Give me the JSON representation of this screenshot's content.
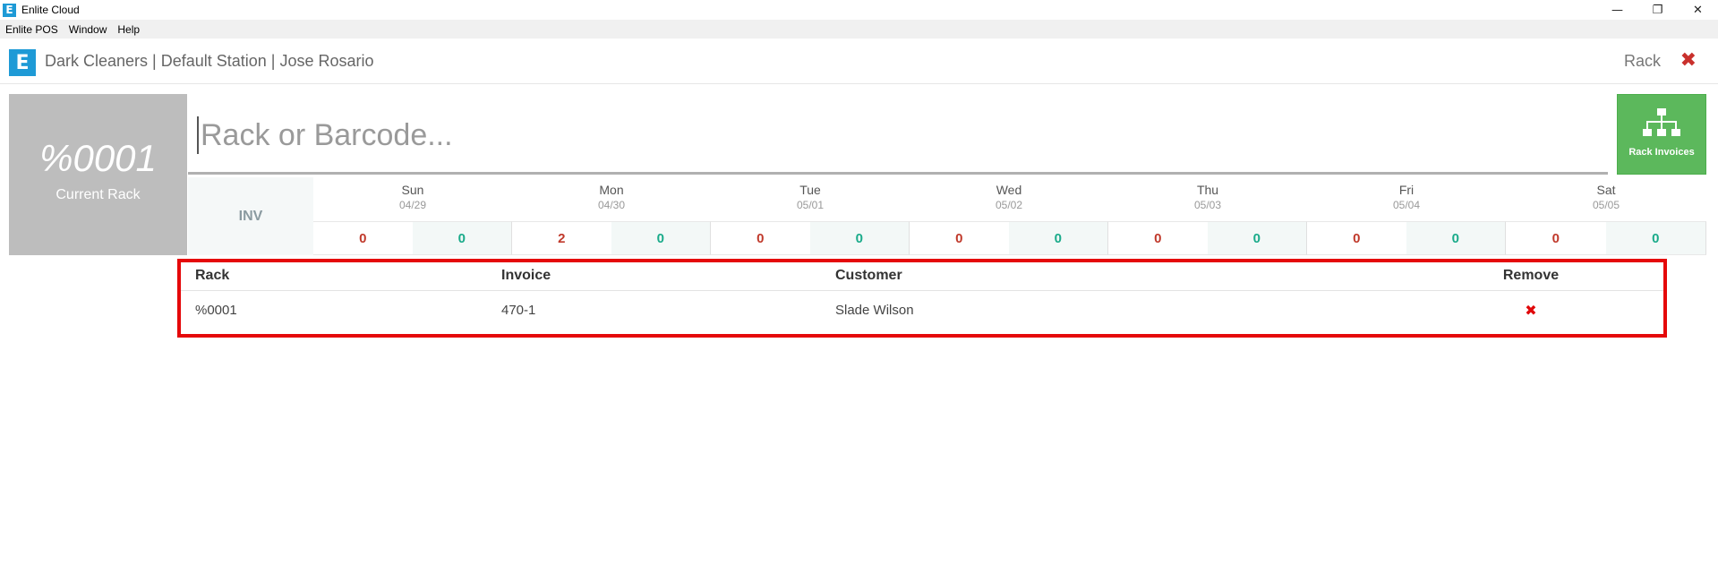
{
  "window": {
    "icon": "E",
    "title": "Enlite Cloud",
    "controls": {
      "minimize": "—",
      "restore": "❐",
      "close": "✕"
    }
  },
  "menu": [
    "Enlite POS",
    "Window",
    "Help"
  ],
  "header": {
    "logo": "E",
    "title": "Dark Cleaners | Default Station | Jose Rosario",
    "right_label": "Rack",
    "close_glyph": "✖"
  },
  "current_rack": {
    "value": "%0001",
    "label": "Current Rack"
  },
  "search": {
    "placeholder": "Rack or Barcode..."
  },
  "rack_invoices_button": {
    "label": "Rack Invoices",
    "icon": "sitemap-icon"
  },
  "schedule": {
    "inv_label": "INV",
    "days": [
      {
        "name": "Sun",
        "date": "04/29",
        "left": "0",
        "right": "0"
      },
      {
        "name": "Mon",
        "date": "04/30",
        "left": "2",
        "right": "0"
      },
      {
        "name": "Tue",
        "date": "05/01",
        "left": "0",
        "right": "0"
      },
      {
        "name": "Wed",
        "date": "05/02",
        "left": "0",
        "right": "0"
      },
      {
        "name": "Thu",
        "date": "05/03",
        "left": "0",
        "right": "0"
      },
      {
        "name": "Fri",
        "date": "05/04",
        "left": "0",
        "right": "0"
      },
      {
        "name": "Sat",
        "date": "05/05",
        "left": "0",
        "right": "0"
      }
    ]
  },
  "table": {
    "headers": {
      "rack": "Rack",
      "invoice": "Invoice",
      "customer": "Customer",
      "remove": "Remove"
    },
    "rows": [
      {
        "rack": "%0001",
        "invoice": "470-1",
        "customer": "Slade Wilson",
        "remove": "✖"
      }
    ]
  },
  "colors": {
    "brand_blue": "#1e9ad6",
    "green_button": "#5cb85c",
    "highlight_red": "#e5080a",
    "count_red": "#c0392b",
    "count_teal": "#1aab8a"
  }
}
